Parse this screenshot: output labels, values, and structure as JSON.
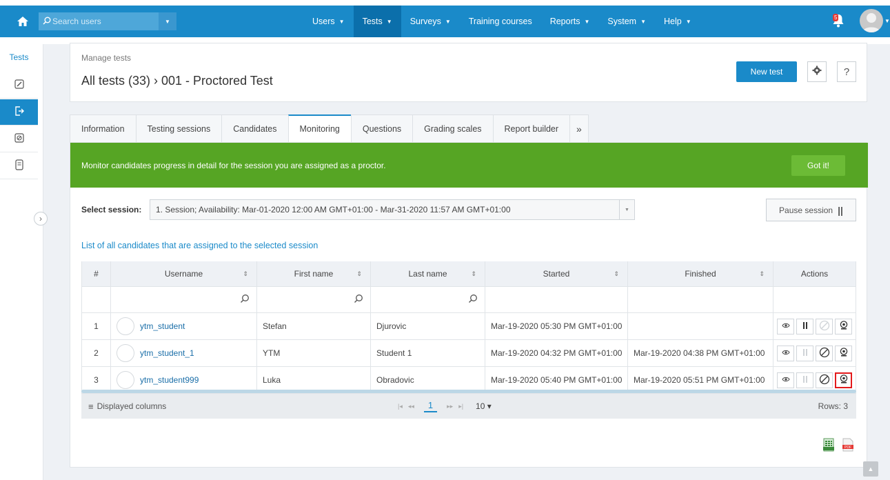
{
  "nav": {
    "search_placeholder": "Search users",
    "menu": [
      {
        "label": "Users",
        "has_caret": true
      },
      {
        "label": "Tests",
        "has_caret": true,
        "active": true
      },
      {
        "label": "Surveys",
        "has_caret": true
      },
      {
        "label": "Training courses",
        "has_caret": false
      },
      {
        "label": "Reports",
        "has_caret": true
      },
      {
        "label": "System",
        "has_caret": true
      },
      {
        "label": "Help",
        "has_caret": true
      }
    ],
    "caret_glyph": "▼",
    "notification_count": "5"
  },
  "rail": {
    "title": "Tests",
    "items": [
      "edit-icon",
      "exit-icon",
      "forbidden-icon",
      "document-icon"
    ]
  },
  "header": {
    "breadcrumb_small": "Manage tests",
    "breadcrumb_big": "All tests (33) › 001 - Proctored Test",
    "new_test_label": "New test",
    "help_label": "?"
  },
  "tabs": [
    {
      "label": "Information"
    },
    {
      "label": "Testing sessions"
    },
    {
      "label": "Candidates"
    },
    {
      "label": "Monitoring",
      "active": true
    },
    {
      "label": "Questions"
    },
    {
      "label": "Grading scales"
    },
    {
      "label": "Report builder"
    },
    {
      "label": "»",
      "more": true
    }
  ],
  "banner": {
    "text": "Monitor candidates progress in detail for the session you are assigned as a proctor.",
    "button": "Got it!"
  },
  "session": {
    "label": "Select session:",
    "value": "1. Session; Availability: Mar-01-2020 12:00 AM GMT+01:00 - Mar-31-2020 11:57 AM GMT+01:00",
    "pause_label": "Pause session"
  },
  "list_title": "List of all candidates that are assigned to the selected session",
  "table": {
    "headers": {
      "num": "#",
      "username": "Username",
      "first": "First name",
      "last": "Last name",
      "started": "Started",
      "finished": "Finished",
      "actions": "Actions"
    },
    "sort_glyph": "⇕",
    "rows": [
      {
        "num": "1",
        "username": "ytm_student",
        "first": "Stefan",
        "last": "Djurovic",
        "started": "Mar-19-2020 05:30 PM GMT+01:00",
        "finished": "",
        "pause_enabled": true,
        "cancel_enabled": false,
        "webcam_highlight": false
      },
      {
        "num": "2",
        "username": "ytm_student_1",
        "first": "YTM",
        "last": "Student 1",
        "started": "Mar-19-2020 04:32 PM GMT+01:00",
        "finished": "Mar-19-2020 04:38 PM GMT+01:00",
        "pause_enabled": false,
        "cancel_enabled": true,
        "webcam_highlight": false
      },
      {
        "num": "3",
        "username": "ytm_student999",
        "first": "Luka",
        "last": "Obradovic",
        "started": "Mar-19-2020 05:40 PM GMT+01:00",
        "finished": "Mar-19-2020 05:51 PM GMT+01:00",
        "pause_enabled": false,
        "cancel_enabled": true,
        "webcam_highlight": true
      }
    ],
    "footer": {
      "displayed_columns": "Displayed columns",
      "current_page": "1",
      "page_size": "10 ▾",
      "rows": "Rows: 3"
    }
  },
  "colors": {
    "primary": "#1a8ac9",
    "banner": "#56a524",
    "highlight": "#e3191b"
  }
}
